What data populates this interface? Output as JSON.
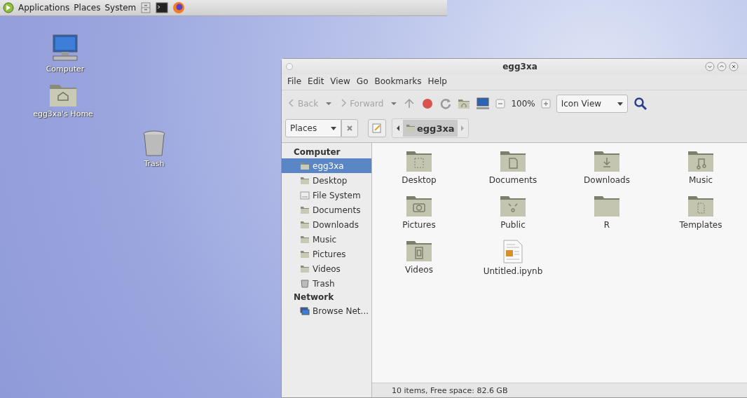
{
  "top_panel": {
    "menus": [
      "Applications",
      "Places",
      "System"
    ]
  },
  "desktop_icons": [
    {
      "label": "Computer",
      "kind": "computer"
    },
    {
      "label": "egg3xa's Home",
      "kind": "home"
    },
    {
      "label": "Trash",
      "kind": "trash"
    }
  ],
  "window": {
    "title": "egg3xa",
    "menu": [
      "File",
      "Edit",
      "View",
      "Go",
      "Bookmarks",
      "Help"
    ],
    "toolbar": {
      "back": {
        "label": "Back",
        "disabled": true
      },
      "forward": {
        "label": "Forward",
        "disabled": true
      },
      "zoom": "100%",
      "view_select": "Icon View"
    },
    "places_select": "Places",
    "breadcrumb": "egg3xa",
    "sidebar": [
      {
        "heading": "Computer",
        "items": [
          {
            "label": "egg3xa",
            "kind": "home",
            "selected": true
          },
          {
            "label": "Desktop",
            "kind": "folder",
            "selected": false
          },
          {
            "label": "File System",
            "kind": "drive",
            "selected": false
          },
          {
            "label": "Documents",
            "kind": "folder",
            "selected": false
          },
          {
            "label": "Downloads",
            "kind": "folder",
            "selected": false
          },
          {
            "label": "Music",
            "kind": "folder",
            "selected": false
          },
          {
            "label": "Pictures",
            "kind": "folder",
            "selected": false
          },
          {
            "label": "Videos",
            "kind": "folder",
            "selected": false
          },
          {
            "label": "Trash",
            "kind": "trash",
            "selected": false
          }
        ]
      },
      {
        "heading": "Network",
        "items": [
          {
            "label": "Browse Net...",
            "kind": "network",
            "selected": false
          }
        ]
      }
    ],
    "files": [
      {
        "name": "Desktop",
        "kind": "desktop"
      },
      {
        "name": "Documents",
        "kind": "documents"
      },
      {
        "name": "Downloads",
        "kind": "downloads"
      },
      {
        "name": "Music",
        "kind": "music"
      },
      {
        "name": "Pictures",
        "kind": "pictures"
      },
      {
        "name": "Public",
        "kind": "public"
      },
      {
        "name": "R",
        "kind": "plain"
      },
      {
        "name": "Templates",
        "kind": "templates"
      },
      {
        "name": "Videos",
        "kind": "videos"
      },
      {
        "name": "Untitled.ipynb",
        "kind": "file"
      }
    ],
    "status": "10 items, Free space: 82.6 GB"
  }
}
